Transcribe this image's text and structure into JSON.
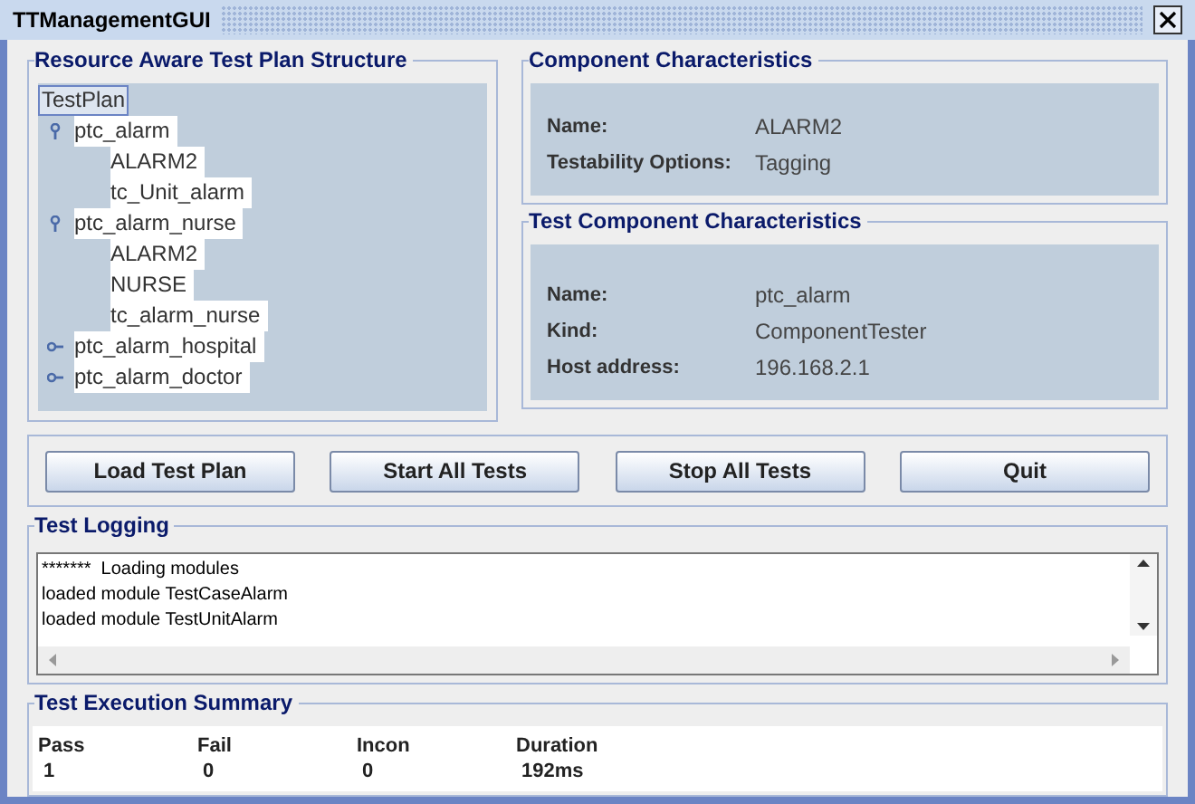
{
  "window": {
    "title": "TTManagementGUI"
  },
  "tree": {
    "title": "Resource Aware Test Plan Structure",
    "root": {
      "label": "TestPlan",
      "selected": true,
      "children": [
        {
          "label": "ptc_alarm",
          "expanded": true,
          "children": [
            {
              "label": "ALARM2"
            },
            {
              "label": "tc_Unit_alarm"
            }
          ]
        },
        {
          "label": "ptc_alarm_nurse",
          "expanded": true,
          "children": [
            {
              "label": "ALARM2"
            },
            {
              "label": "NURSE"
            },
            {
              "label": "tc_alarm_nurse"
            }
          ]
        },
        {
          "label": "ptc_alarm_hospital",
          "expanded": false
        },
        {
          "label": "ptc_alarm_doctor",
          "expanded": false
        }
      ]
    }
  },
  "component": {
    "title": "Component Characteristics",
    "fields": [
      {
        "label": "Name:",
        "value": "ALARM2"
      },
      {
        "label": "Testability Options:",
        "value": "Tagging"
      }
    ]
  },
  "test_component": {
    "title": "Test Component Characteristics",
    "fields": [
      {
        "label": "Name:",
        "value": "ptc_alarm"
      },
      {
        "label": "Kind:",
        "value": "ComponentTester"
      },
      {
        "label": "Host address:",
        "value": "196.168.2.1"
      }
    ]
  },
  "buttons": [
    "Load Test Plan",
    "Start All Tests",
    "Stop All Tests",
    "Quit"
  ],
  "logging": {
    "title": "Test Logging",
    "lines": [
      "*******  Loading modules",
      "loaded module TestCaseAlarm",
      "loaded module TestUnitAlarm"
    ]
  },
  "summary": {
    "title": "Test Execution Summary",
    "columns": [
      {
        "label": "Pass",
        "value": "1"
      },
      {
        "label": "Fail",
        "value": "0"
      },
      {
        "label": "Incon",
        "value": "0"
      },
      {
        "label": "Duration",
        "value": "192ms"
      }
    ]
  }
}
